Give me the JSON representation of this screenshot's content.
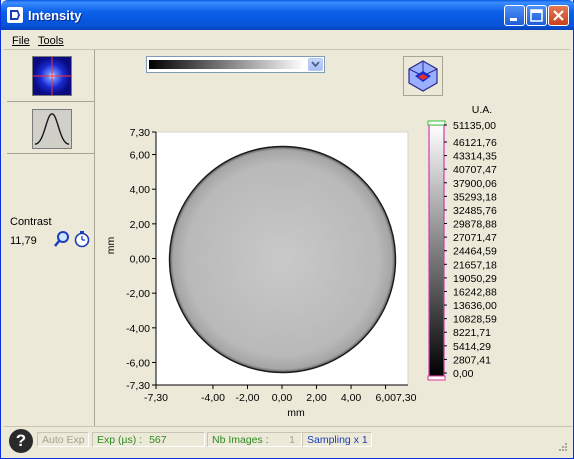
{
  "window": {
    "title": "Intensity"
  },
  "menu": {
    "file": "File",
    "tools": "Tools"
  },
  "left": {
    "contrast_label": "Contrast",
    "contrast_value": "11,79"
  },
  "colorbar": {
    "unit_label": "U.A.",
    "ticks": [
      "51135,00",
      "46121,76",
      "43314,35",
      "40707,47",
      "37900,06",
      "35293,18",
      "32485,76",
      "29878,88",
      "27071,47",
      "24464,59",
      "21657,18",
      "19050,29",
      "16242,88",
      "13636,00",
      "10828,59",
      "8221,71",
      "5414,29",
      "2807,41",
      "0,00"
    ]
  },
  "plot": {
    "y_ticks": [
      "7,30",
      "6,00",
      "4,00",
      "2,00",
      "0,00",
      "-2,00",
      "-4,00",
      "-6,00",
      "-7,30"
    ],
    "x_ticks": [
      "-7,30",
      "-4,00",
      "-2,00",
      "0,00",
      "2,00",
      "4,00",
      "6,007,30"
    ],
    "x_label": "mm",
    "y_label": "mm"
  },
  "status": {
    "auto_exp": "Auto Exp",
    "exp_label": "Exp (µs) :",
    "exp_value": "567",
    "nb_images_label": "Nb Images :",
    "nb_images_value": "1",
    "sampling": "Sampling x 1",
    "colors": {
      "green_text": "#2f8a1f",
      "blue_text": "#1a3db8",
      "disabled": "#a6a394"
    }
  },
  "icons": [
    "app-icon",
    "minimize-icon",
    "maximize-icon",
    "close-icon",
    "crosshair-image-icon",
    "gaussian-profile-icon",
    "magnifier-icon",
    "timer-icon",
    "palette-dropdown-arrow-icon",
    "3d-cube-icon",
    "help-icon"
  ]
}
